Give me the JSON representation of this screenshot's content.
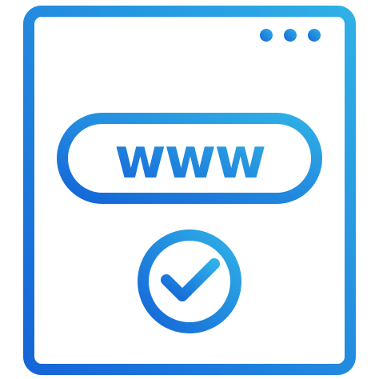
{
  "icon": {
    "name": "browser-www-check-icon",
    "badge_text": "www",
    "window_dots": [
      "dot",
      "dot",
      "dot"
    ],
    "check_icon": "checkmark-circle-icon"
  },
  "colors": {
    "gradient_start": "#1565d8",
    "gradient_end": "#2fb0e6",
    "background": "#ffffff"
  }
}
